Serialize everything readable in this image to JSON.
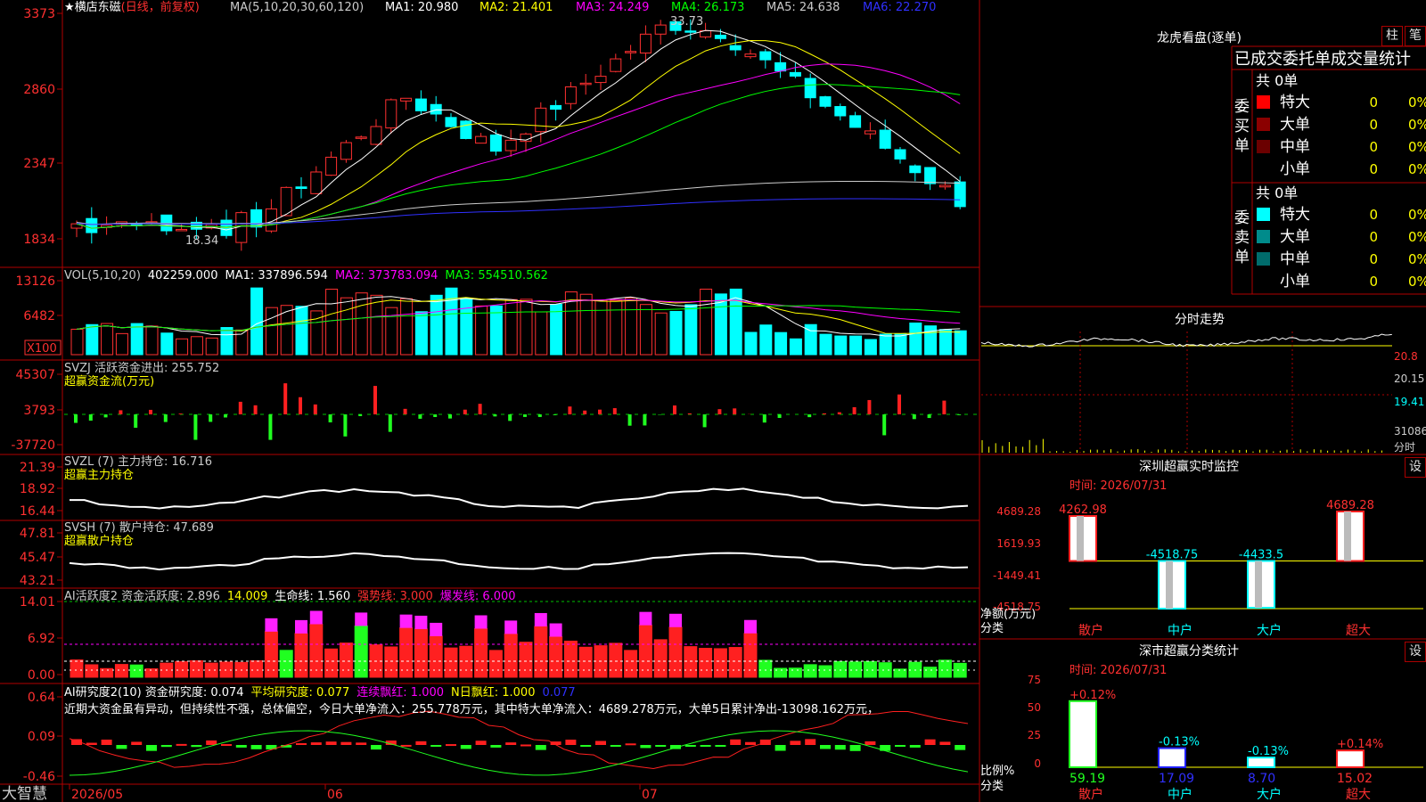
{
  "stock": {
    "name": "横店东磁",
    "period": "(日线，前复权)"
  },
  "ma_legend": {
    "label": "MA(5,10,20,30,60,120)",
    "ma1": "MA1: 20.980",
    "ma2": "MA2: 21.401",
    "ma3": "MA3: 24.249",
    "ma4": "MA4: 26.173",
    "ma5": "MA5: 24.638",
    "ma6": "MA6: 22.270"
  },
  "price_axis": {
    "labels": [
      "3373",
      "2860",
      "2347",
      "1834"
    ]
  },
  "price_marks": {
    "high": "33.73",
    "low": "18.34"
  },
  "vol_panel": {
    "legend": "VOL(5,10,20)",
    "value": "402259.000",
    "ma1": "MA1: 337896.594",
    "ma2": "MA2: 373783.094",
    "ma3": "MA3: 554510.562",
    "axis": [
      "13126",
      "6482"
    ],
    "unit": "X100"
  },
  "svzj_panel": {
    "legend": "SVZJ  活跃资金进出: 255.752",
    "sub": "超赢资金流(万元)",
    "axis": [
      "45307",
      "3793",
      "-37720"
    ]
  },
  "svzl_panel": {
    "legend": "SVZL (7) 主力持仓: 16.716",
    "sub": "超赢主力持仓",
    "axis": [
      "21.39",
      "18.92",
      "16.44"
    ]
  },
  "svsh_panel": {
    "legend": "SVSH (7) 散户持仓: 47.689",
    "sub": "超赢散户持仓",
    "axis": [
      "47.81",
      "45.47",
      "43.21"
    ]
  },
  "ai_panel": {
    "legend1": "AI活跃度2 资金活跃度: 2.896",
    "legend2": "14.009",
    "legend3": "生命线: 1.560",
    "legend4": "强势线: 3.000",
    "legend5": "爆发线: 6.000",
    "axis": [
      "14.01",
      "6.92",
      "0.00"
    ]
  },
  "research_panel": {
    "legend1": "AI研究度2(10) 资金研究度: 0.074",
    "legend2": "平均研究度: 0.077",
    "legend3": "连续飘红: 1.000",
    "legend4": "N日飘红: 1.000",
    "legend5": "0.077",
    "text": "近期大资金虽有异动，但持续性不强，总体偏空，今日大单净流入：255.778万元，其中特大单净流入：4689.278万元，大单5日累计净出-13098.162万元，",
    "axis": [
      "0.64",
      "0.09",
      "-0.46"
    ]
  },
  "date_axis": {
    "labels": [
      "2026/05",
      "06",
      "07"
    ]
  },
  "brand": "大智慧",
  "lhb": {
    "title": "龙虎看盘(逐单)",
    "btn_zhu": "柱",
    "btn_bi": "笔",
    "header": "已成交委托单成交量统计",
    "buy": {
      "side": "委买单",
      "total": "共 0单",
      "rows": [
        {
          "label": "特大",
          "n": "0",
          "pct": "0%",
          "color": "#ff0000"
        },
        {
          "label": "大单",
          "n": "0",
          "pct": "0%",
          "color": "#8b0000"
        },
        {
          "label": "中单",
          "n": "0",
          "pct": "0%",
          "color": "#6b0000"
        },
        {
          "label": "小单",
          "n": "0",
          "pct": "0%",
          "color": "#000000"
        }
      ]
    },
    "sell": {
      "side": "委卖单",
      "total": "共 0单",
      "rows": [
        {
          "label": "特大",
          "n": "0",
          "pct": "0%",
          "color": "#00ffff"
        },
        {
          "label": "大单",
          "n": "0",
          "pct": "0%",
          "color": "#008b8b"
        },
        {
          "label": "中单",
          "n": "0",
          "pct": "0%",
          "color": "#006b6b"
        },
        {
          "label": "小单",
          "n": "0",
          "pct": "0%",
          "color": "#000000"
        }
      ]
    }
  },
  "intraday": {
    "title": "分时走势",
    "axis": [
      "20.8",
      "20.15",
      "19.41"
    ],
    "vol_axis": "31086",
    "vol_label": "分时"
  },
  "monitor": {
    "title": "深圳超赢实时监控",
    "btn": "设",
    "time": "时间: 2026/07/31",
    "axis": [
      "4689.28",
      "1619.93",
      "-1449.41",
      "-4518.75"
    ],
    "unit": "净额(万元)",
    "cat_label": "分类",
    "bars": [
      {
        "cat": "散户",
        "value": 4262.98,
        "label": "4262.98"
      },
      {
        "cat": "中户",
        "value": -4518.75,
        "label": "-4518.75"
      },
      {
        "cat": "大户",
        "value": -4433.5,
        "label": "-4433.5"
      },
      {
        "cat": "超大",
        "value": 4689.28,
        "label": "4689.28"
      }
    ]
  },
  "classify": {
    "title": "深市超赢分类统计",
    "btn": "设",
    "time": "时间: 2026/07/31",
    "axis": [
      "75",
      "50",
      "25",
      "0"
    ],
    "unit": "比例%",
    "cat_label": "分类",
    "bars": [
      {
        "cat": "散户",
        "value": 59.19,
        "top": "+0.12%",
        "bottom": "59.19"
      },
      {
        "cat": "中户",
        "value": 17.09,
        "top": "-0.13%",
        "bottom": "17.09"
      },
      {
        "cat": "大户",
        "value": 8.7,
        "top": "-0.13%",
        "bottom": "8.70"
      },
      {
        "cat": "超大",
        "value": 15.02,
        "top": "+0.14%",
        "bottom": "15.02"
      }
    ]
  }
}
